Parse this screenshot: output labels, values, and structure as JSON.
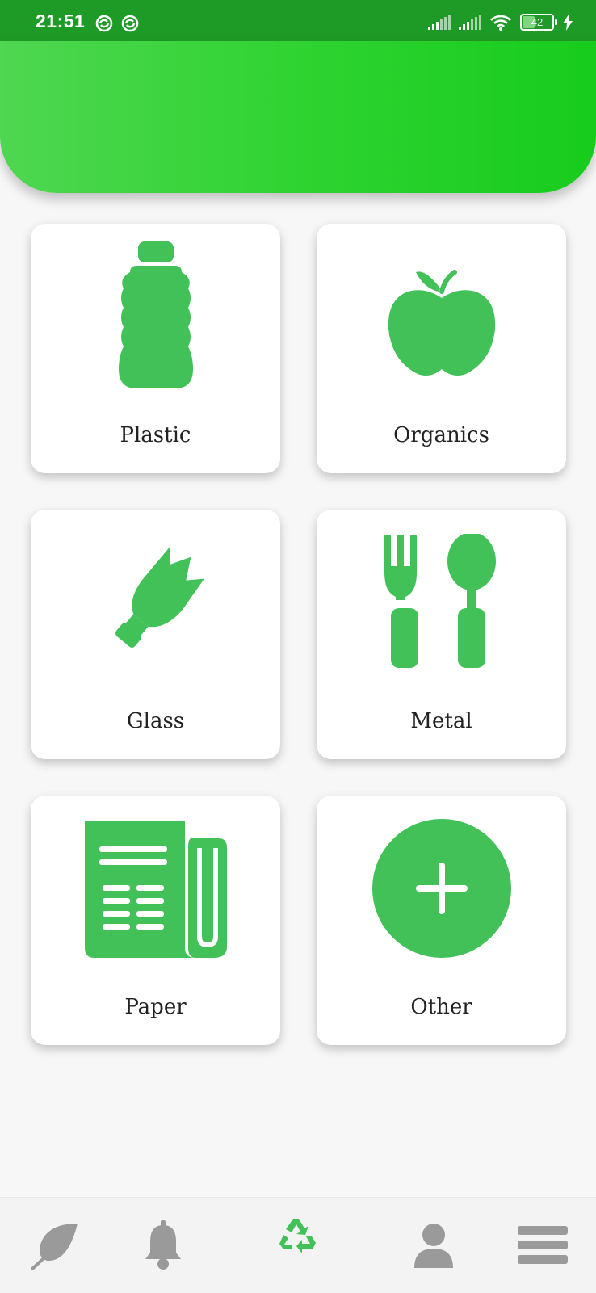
{
  "status_bar": {
    "time": "21:51",
    "battery_level": "42",
    "icons": [
      "sync-icon",
      "sync-icon",
      "signal-icon",
      "signal-icon",
      "wifi-icon",
      "battery-icon",
      "charging-icon"
    ]
  },
  "colors": {
    "header_start": "#4fd652",
    "header_end": "#17cc1d",
    "accent": "#43c159",
    "nav_inactive": "#9a9a9a"
  },
  "categories": [
    {
      "label": "Plastic",
      "icon": "bottle-icon"
    },
    {
      "label": "Organics",
      "icon": "apple-icon"
    },
    {
      "label": "Glass",
      "icon": "broken-bottle-icon"
    },
    {
      "label": "Metal",
      "icon": "fork-spoon-icon"
    },
    {
      "label": "Paper",
      "icon": "newspaper-icon"
    },
    {
      "label": "Other",
      "icon": "plus-circle-icon"
    }
  ],
  "bottom_nav": {
    "items": [
      {
        "icon": "leaf-icon",
        "active": false
      },
      {
        "icon": "bell-icon",
        "active": false
      },
      {
        "icon": "recycle-icon",
        "active": true
      },
      {
        "icon": "user-icon",
        "active": false
      },
      {
        "icon": "menu-icon",
        "active": false
      }
    ]
  }
}
